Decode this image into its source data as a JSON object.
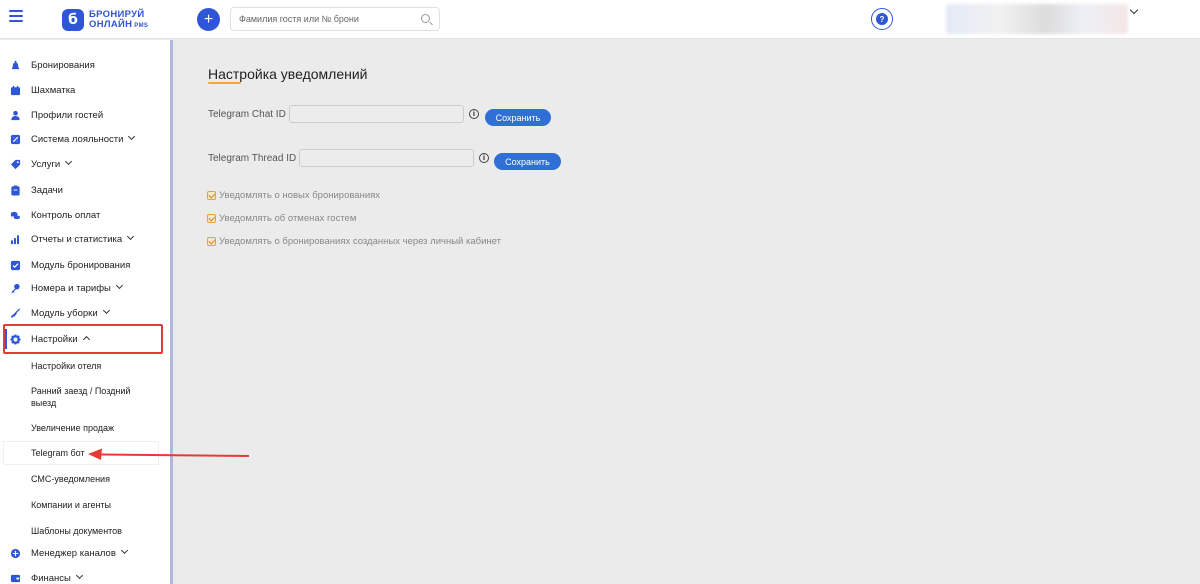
{
  "header": {
    "logo_line1": "БРОНИРУЙ",
    "logo_line2": "ОНЛАЙН",
    "logo_pms": "PMS",
    "search_placeholder": "Фамилия гостя или № брони"
  },
  "sidebar": {
    "items": [
      {
        "label": "Бронирования",
        "icon": "bell-icon"
      },
      {
        "label": "Шахматка",
        "icon": "calendar-icon"
      },
      {
        "label": "Профили гостей",
        "icon": "user-icon"
      },
      {
        "label": "Система лояльности",
        "icon": "loyalty-icon"
      },
      {
        "label": "Услуги",
        "icon": "tag-icon"
      },
      {
        "label": "Задачи",
        "icon": "clipboard-icon"
      },
      {
        "label": "Контроль оплат",
        "icon": "coins-icon"
      },
      {
        "label": "Отчеты и статистика",
        "icon": "bar-chart-icon"
      },
      {
        "label": "Модуль бронирования",
        "icon": "check-square-icon"
      },
      {
        "label": "Номера и тарифы",
        "icon": "key-icon"
      },
      {
        "label": "Модуль уборки",
        "icon": "broom-icon"
      },
      {
        "label": "Настройки",
        "icon": "gear-icon"
      }
    ],
    "settings_sub": [
      "Настройки отеля",
      "Ранний заезд / Поздний выезд",
      "Увеличение продаж",
      "Telegram бот",
      "СМС-уведомления",
      "Компании и агенты",
      "Шаблоны документов"
    ],
    "bottom_items": [
      {
        "label": "Менеджер каналов",
        "icon": "channels-icon"
      },
      {
        "label": "Финансы",
        "icon": "finance-icon"
      }
    ]
  },
  "main": {
    "title": "Настройка уведомлений",
    "chat_id_label": "Telegram Chat ID",
    "chat_id_value": "",
    "thread_id_label": "Telegram Thread ID",
    "thread_id_value": "",
    "save_label": "Сохранить",
    "info_glyph": "i",
    "checkboxes": [
      {
        "label": "Уведомлять о новых бронированиях",
        "checked": true
      },
      {
        "label": "Уведомлять об отменах гостем",
        "checked": true
      },
      {
        "label": "Уведомлять о бронированиях созданных через личный кабинет",
        "checked": true
      }
    ]
  },
  "colors": {
    "accent": "#2f56d6",
    "highlight": "#e63b35",
    "checkbox": "#e4a43a"
  }
}
